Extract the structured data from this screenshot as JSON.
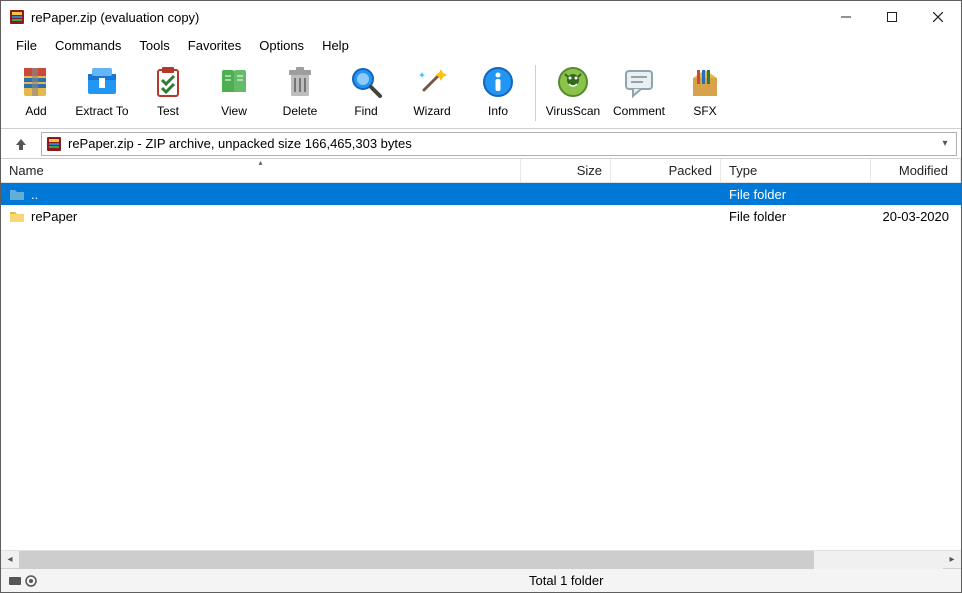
{
  "title": "rePaper.zip (evaluation copy)",
  "menu": [
    "File",
    "Commands",
    "Tools",
    "Favorites",
    "Options",
    "Help"
  ],
  "toolbar": [
    {
      "label": "Add",
      "icon": "add"
    },
    {
      "label": "Extract To",
      "icon": "extract"
    },
    {
      "label": "Test",
      "icon": "test"
    },
    {
      "label": "View",
      "icon": "view"
    },
    {
      "label": "Delete",
      "icon": "delete"
    },
    {
      "label": "Find",
      "icon": "find"
    },
    {
      "label": "Wizard",
      "icon": "wizard"
    },
    {
      "label": "Info",
      "icon": "info"
    },
    {
      "sep": true
    },
    {
      "label": "VirusScan",
      "icon": "virus"
    },
    {
      "label": "Comment",
      "icon": "comment"
    },
    {
      "label": "SFX",
      "icon": "sfx"
    }
  ],
  "address": "rePaper.zip - ZIP archive, unpacked size 166,465,303 bytes",
  "columns": {
    "name": "Name",
    "size": "Size",
    "packed": "Packed",
    "type": "Type",
    "modified": "Modified"
  },
  "rows": [
    {
      "name": "..",
      "size": "",
      "packed": "",
      "type": "File folder",
      "modified": "",
      "selected": true,
      "icon": "updir"
    },
    {
      "name": "rePaper",
      "size": "",
      "packed": "",
      "type": "File folder",
      "modified": "20-03-2020",
      "selected": false,
      "icon": "folder"
    }
  ],
  "status": {
    "total": "Total 1 folder"
  }
}
